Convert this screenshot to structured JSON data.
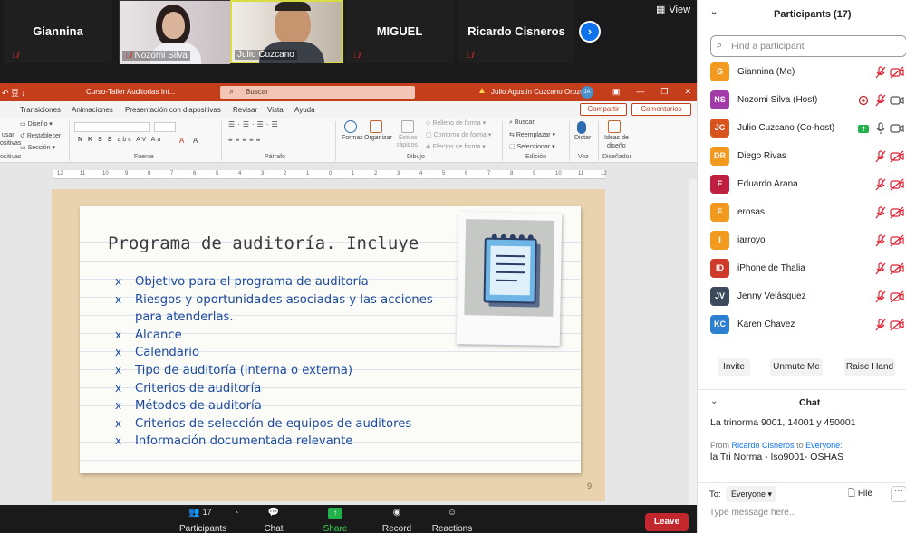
{
  "gallery": {
    "tiles": [
      "Giannina",
      "Nozomi Silva",
      "Julio Cuzcano",
      "MIGUEL",
      "Ricardo Cisneros"
    ],
    "view_label": "View"
  },
  "ppt": {
    "doc_title": "Curso-Taller Auditorias Int...",
    "search_placeholder": "Buscar",
    "user": "Julio Agustin Cuzcano Orozco",
    "user_initials": "JA",
    "tabs": [
      "Transiciones",
      "Animaciones",
      "Presentación con diapositivas",
      "Revisar",
      "Vista",
      "Ayuda"
    ],
    "share_label": "Compartir",
    "comments_label": "Comentarios",
    "ribbon": {
      "reuse_1": "usar",
      "reuse_2": "ositivas",
      "design": "Diseño",
      "reset": "Restablecer",
      "section": "Sección",
      "shapes": "Formas",
      "arrange": "Organizar",
      "quick_styles_1": "Estilos",
      "quick_styles_2": "rápidos",
      "shape_fill": "Relleno de forma",
      "shape_outline": "Contorno de forma",
      "shape_effects": "Efectos de forma",
      "find": "Buscar",
      "replace": "Reemplazar",
      "select": "Seleccionar",
      "dictate": "Dictar",
      "ideas_1": "Ideas de",
      "ideas_2": "diseño",
      "grp_slides": "ositivas",
      "grp_font": "Fuente",
      "grp_paragraph": "Párrafo",
      "grp_drawing": "Dibujo",
      "grp_editing": "Edición",
      "grp_voice": "Voz",
      "grp_designer": "Diseñador"
    },
    "ruler_marks": [
      "12",
      "11",
      "10",
      "9",
      "8",
      "7",
      "6",
      "5",
      "4",
      "3",
      "2",
      "1",
      "0",
      "1",
      "2",
      "3",
      "4",
      "5",
      "6",
      "7",
      "8",
      "9",
      "10",
      "11",
      "12"
    ]
  },
  "slide": {
    "title": "Programa de auditoría. Incluye",
    "bullet_mark": "x",
    "bullets": [
      "Objetivo para el programa de auditoría",
      "Riesgos y oportunidades asociadas y las acciones para atenderlas.",
      "Alcance",
      "Calendario",
      "Tipo de auditoría (interna o externa)",
      "Criterios de auditoría",
      "Métodos de auditoría",
      "Criterios de selección de equipos de auditores",
      "Información documentada relevante"
    ],
    "page_number": "9"
  },
  "toolbar": {
    "participants_label": "Participants",
    "participants_count": "17",
    "chat_label": "Chat",
    "share_label": "Share Screen",
    "record_label": "Record",
    "reactions_label": "Reactions",
    "leave_label": "Leave"
  },
  "panel": {
    "participants_title": "Participants (17)",
    "find_placeholder": "Find a participant",
    "participants": [
      {
        "initials": "G",
        "name": "Giannina (Me)",
        "color": "#f29a1f"
      },
      {
        "initials": "NS",
        "name": "Nozomi Silva (Host)",
        "color": "#a23aa8"
      },
      {
        "initials": "JC",
        "name": "Julio Cuzcano (Co-host)",
        "color": "#d9531e"
      },
      {
        "initials": "DR",
        "name": "Diego Rivas",
        "color": "#f29a1f"
      },
      {
        "initials": "E",
        "name": "Eduardo Arana",
        "color": "#c0203f"
      },
      {
        "initials": "E",
        "name": "erosas",
        "color": "#f29a1f"
      },
      {
        "initials": "I",
        "name": "iarroyo",
        "color": "#f29a1f"
      },
      {
        "initials": "ID",
        "name": "iPhone de Thalia",
        "color": "#cf3b2b"
      },
      {
        "initials": "JV",
        "name": "Jenny Velásquez",
        "color": "#3d4a5c"
      },
      {
        "initials": "KC",
        "name": "Karen Chavez",
        "color": "#2d7fd0"
      }
    ],
    "invite_label": "Invite",
    "unmute_label": "Unmute Me",
    "raise_label": "Raise Hand",
    "chat_title": "Chat",
    "messages": {
      "msg1": "La trinorma 9001, 14001 y 450001",
      "from_prefix": "From",
      "from_name": "Ricardo Cisneros",
      "to_word": "to",
      "to_name": "Everyone:",
      "msg2": "la Tri Norma - Iso9001- OSHAS"
    },
    "to_label": "To:",
    "to_value": "Everyone",
    "file_label": "File",
    "more_label": "···",
    "type_placeholder": "Type message here..."
  }
}
